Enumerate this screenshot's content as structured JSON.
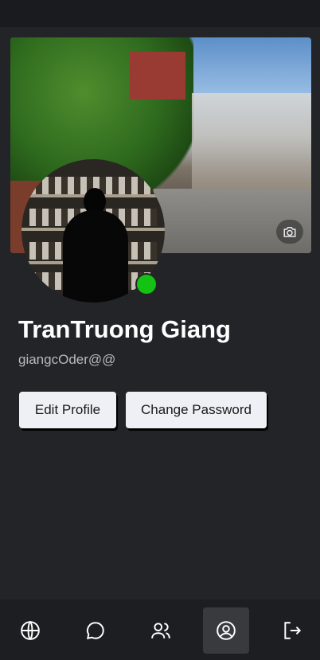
{
  "profile": {
    "display_name": "TranTruong Giang",
    "username": "giangcOder@@",
    "online_status": "online",
    "status_color": "#13c213"
  },
  "actions": {
    "edit_profile_label": "Edit Profile",
    "change_password_label": "Change Password"
  },
  "cover": {
    "camera_icon": "camera-icon"
  },
  "nav": {
    "items": [
      {
        "icon": "globe-icon",
        "active": false
      },
      {
        "icon": "chat-bubble-icon",
        "active": false
      },
      {
        "icon": "users-icon",
        "active": false
      },
      {
        "icon": "user-circle-icon",
        "active": true
      },
      {
        "icon": "logout-icon",
        "active": false
      }
    ]
  }
}
